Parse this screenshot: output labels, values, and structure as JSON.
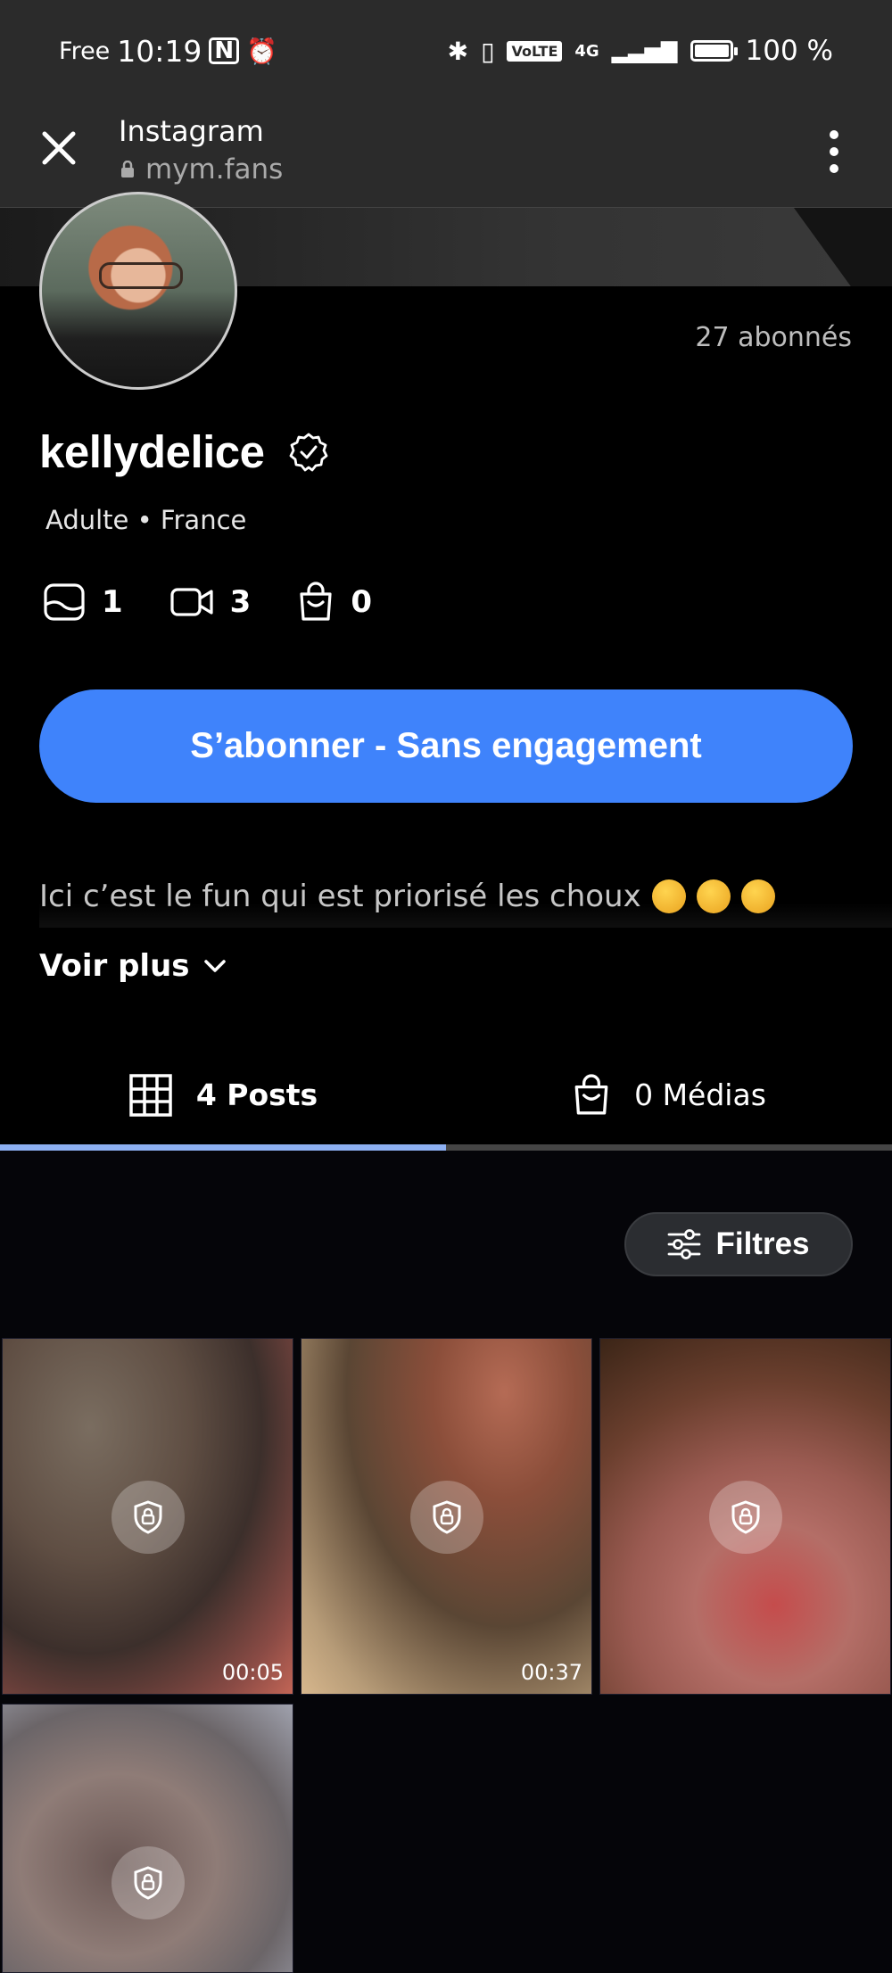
{
  "status_bar": {
    "carrier": "Free",
    "time": "10:19",
    "network_chip": "VoLTE",
    "network": "4G",
    "battery_level": 1.0,
    "battery": "100 %"
  },
  "browser": {
    "title": "Instagram",
    "url": "mym.fans"
  },
  "profile": {
    "subscribers": "27 abonnés",
    "username": "kellydelice",
    "tags": "Adulte • France",
    "stats": [
      {
        "icon": "photo-icon",
        "value": "1"
      },
      {
        "icon": "video-icon",
        "value": "3"
      },
      {
        "icon": "bag-icon",
        "value": "0"
      }
    ],
    "subscribe_label": "S’abonner - Sans engagement",
    "bio": "Ici c’est le fun qui est priorisé les choux",
    "voir_plus": "Voir plus"
  },
  "tabs": {
    "posts": "4 Posts",
    "medias": "0 Médias",
    "active": "posts"
  },
  "filters_label": "Filtres",
  "posts": [
    {
      "duration": "00:05",
      "locked": true
    },
    {
      "duration": "00:37",
      "locked": true
    },
    {
      "duration": "",
      "locked": true
    },
    {
      "duration": "",
      "locked": true
    }
  ],
  "colors": {
    "accent": "#3f83fb",
    "tab_indicator": "#8db0f2",
    "background": "#000000"
  }
}
